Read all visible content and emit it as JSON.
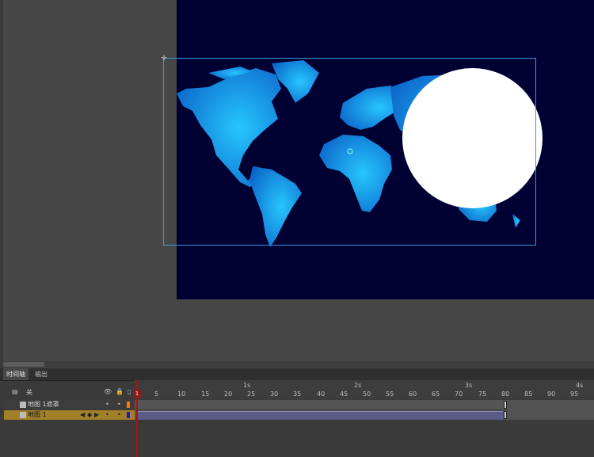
{
  "tabs": [
    "时间轴",
    "输出"
  ],
  "timeline_header": {
    "label": "关"
  },
  "layers": [
    {
      "name": "地图 1遮罩",
      "color": "#ff7700"
    },
    {
      "name": "地图 1",
      "color": "#1b1bd8"
    }
  ],
  "ruler": {
    "seconds": [
      "1s",
      "2s",
      "3s",
      "4s"
    ],
    "frames": [
      "1",
      "5",
      "10",
      "15",
      "20",
      "25",
      "30",
      "35",
      "40",
      "45",
      "50",
      "55",
      "60",
      "65",
      "70",
      "75",
      "80",
      "85",
      "90",
      "95"
    ]
  },
  "playhead": {
    "frame": "1"
  },
  "stage": {
    "background": "#000033"
  }
}
